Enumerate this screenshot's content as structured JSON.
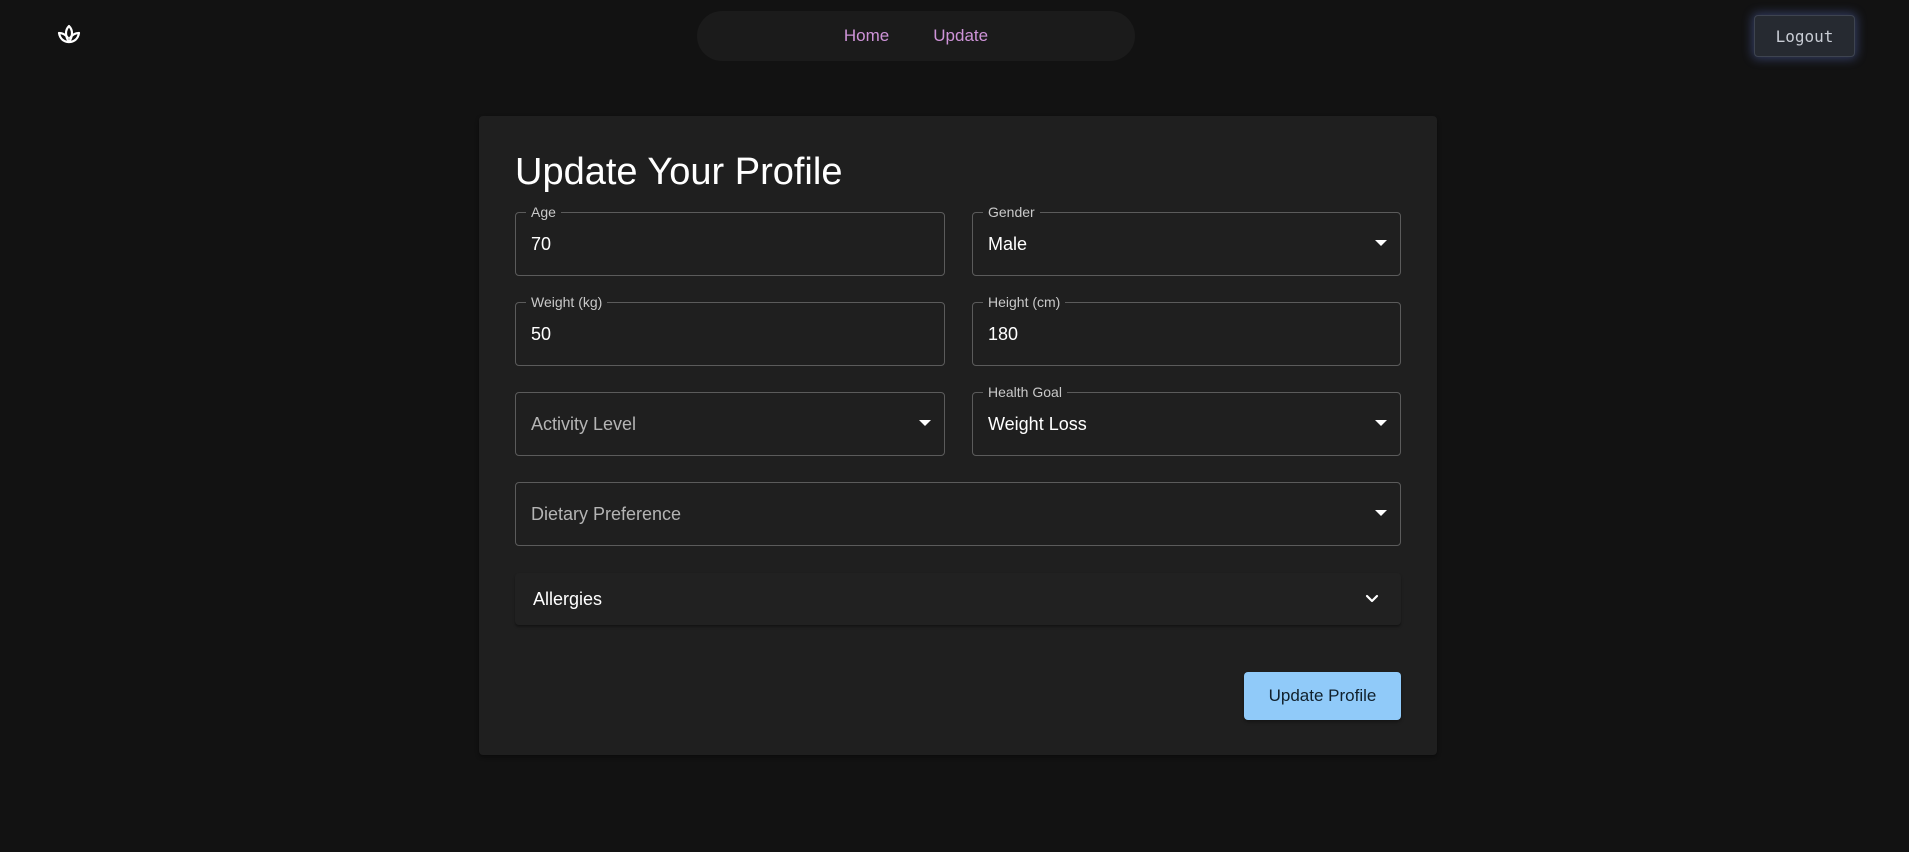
{
  "header": {
    "logo_icon": "lotus-leaf-icon",
    "nav": [
      {
        "label": "Home"
      },
      {
        "label": "Update"
      }
    ],
    "logout_label": "Logout"
  },
  "form": {
    "title": "Update Your Profile",
    "age": {
      "label": "Age",
      "value": "70"
    },
    "gender": {
      "label": "Gender",
      "value": "Male"
    },
    "weight": {
      "label": "Weight (kg)",
      "value": "50"
    },
    "height": {
      "label": "Height (cm)",
      "value": "180"
    },
    "activity_level": {
      "placeholder": "Activity Level"
    },
    "health_goal": {
      "label": "Health Goal",
      "value": "Weight Loss"
    },
    "dietary_preference": {
      "placeholder": "Dietary Preference"
    },
    "allergies": {
      "label": "Allergies",
      "icon": "chevron-down-icon"
    },
    "submit_label": "Update Profile"
  },
  "colors": {
    "background": "#121212",
    "card": "#1f1f1f",
    "nav_link": "#ce93d8",
    "primary_button": "#90caf9"
  }
}
